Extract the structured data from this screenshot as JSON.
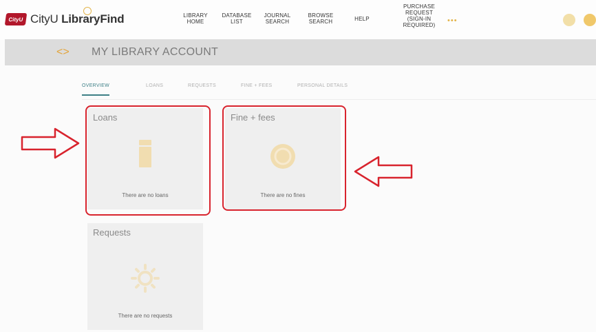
{
  "header": {
    "logo_badge": "CityU",
    "logo_prefix": "CityU ",
    "logo_bold": "Library",
    "logo_suffix": "Find",
    "nav": [
      {
        "line1": "Library",
        "line2": "Home"
      },
      {
        "line1": "Database",
        "line2": "List"
      },
      {
        "line1": "Journal",
        "line2": "Search"
      },
      {
        "line1": "Browse",
        "line2": "Search"
      },
      {
        "line1": "Help",
        "line2": ""
      },
      {
        "line1": "Purchase",
        "line2": "Request",
        "line3": "(Sign-in",
        "line4": "Required)"
      }
    ],
    "more": "•••"
  },
  "page": {
    "title": "MY LIBRARY ACCOUNT"
  },
  "tabs": [
    {
      "label": "Overview",
      "active": true
    },
    {
      "label": "Loans",
      "active": false
    },
    {
      "label": "Requests",
      "active": false
    },
    {
      "label": "Fine + fees",
      "active": false
    },
    {
      "label": "Personal details",
      "active": false
    }
  ],
  "cards": {
    "loans": {
      "title": "Loans",
      "message": "There are no loans"
    },
    "fines": {
      "title": "Fine + fees",
      "message": "There are no fines"
    },
    "requests": {
      "title": "Requests",
      "message": "There are no requests"
    }
  },
  "colors": {
    "annotation": "#d8232d",
    "accent": "#e3a53b",
    "tab_active": "#3c7f86",
    "brand": "#b2172b"
  },
  "icons": {
    "back": "chevron-left-icon",
    "loans": "book-icon",
    "fines": "coin-icon",
    "requests": "gear-icon"
  }
}
